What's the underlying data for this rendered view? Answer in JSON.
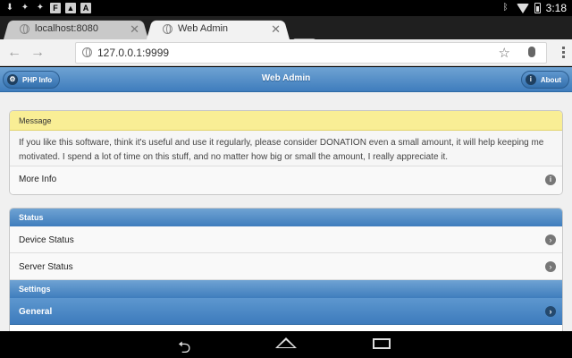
{
  "status_bar": {
    "time": "3:18",
    "left_icons": [
      "download-icon",
      "twitter-icon",
      "twitter-icon",
      "facebook-icon",
      "gallery-icon",
      "font-icon"
    ],
    "left_letters": [
      "F",
      "A"
    ]
  },
  "browser": {
    "tabs": [
      {
        "title": "localhost:8080",
        "active": false
      },
      {
        "title": "Web Admin",
        "active": true
      }
    ],
    "url": "127.0.0.1:9999"
  },
  "header": {
    "left_button": "PHP Info",
    "title": "Web Admin",
    "right_button": "About"
  },
  "message": {
    "heading": "Message",
    "body": "If you like this software, think it's useful and use it regularly, please consider DONATION even a small amount, it will help keeping me motivated. I spend a lot of time on this stuff, and no matter how big or small the amount, I really appreciate it.",
    "more": "More Info"
  },
  "lists": {
    "status_heading": "Status",
    "status_items": [
      "Device Status",
      "Server Status"
    ],
    "settings_heading": "Settings",
    "settings_items": [
      "General"
    ]
  },
  "colors": {
    "header_blue": "#4a86c4",
    "message_yellow": "#f9ee95"
  }
}
